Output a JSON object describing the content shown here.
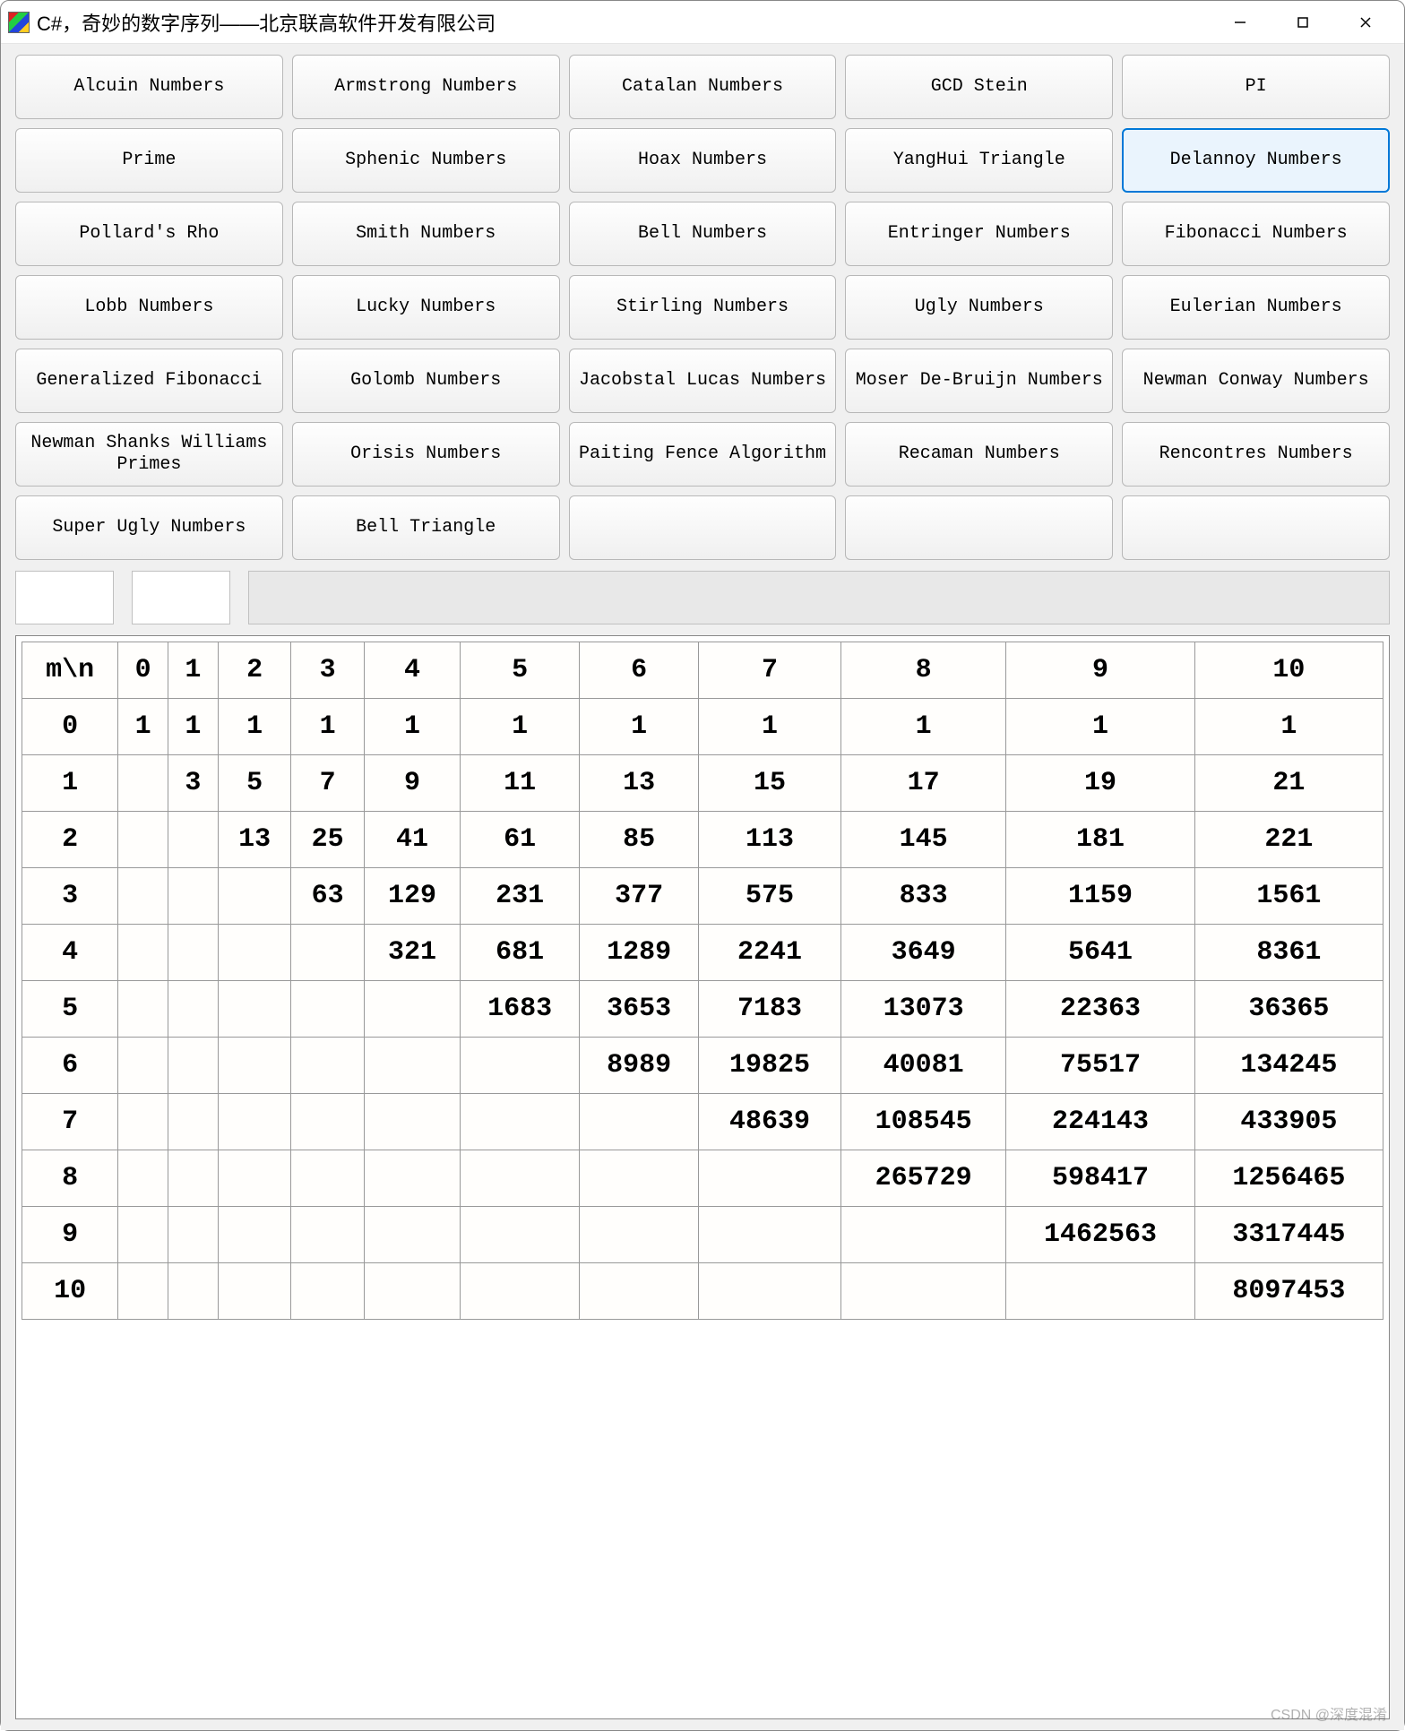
{
  "window": {
    "title": "C#，奇妙的数字序列——北京联高软件开发有限公司"
  },
  "buttons": {
    "rows": [
      [
        "Alcuin Numbers",
        "Armstrong Numbers",
        "Catalan Numbers",
        "GCD Stein",
        "PI"
      ],
      [
        "Prime",
        "Sphenic Numbers",
        "Hoax Numbers",
        "YangHui Triangle",
        "Delannoy Numbers"
      ],
      [
        "Pollard's Rho",
        "Smith Numbers",
        "Bell Numbers",
        "Entringer Numbers",
        "Fibonacci Numbers"
      ],
      [
        "Lobb Numbers",
        "Lucky Numbers",
        "Stirling Numbers",
        "Ugly Numbers",
        "Eulerian Numbers"
      ],
      [
        "Generalized Fibonacci",
        "Golomb Numbers",
        "Jacobstal Lucas Numbers",
        "Moser De-Bruijn Numbers",
        "Newman Conway Numbers"
      ],
      [
        "Newman Shanks Williams Primes",
        "Orisis Numbers",
        "Paiting Fence Algorithm",
        "Recaman Numbers",
        "Rencontres Numbers"
      ],
      [
        "Super Ugly Numbers",
        "Bell Triangle",
        "",
        "",
        ""
      ]
    ],
    "selected": "Delannoy Numbers"
  },
  "chart_data": {
    "type": "table",
    "title": "Delannoy Numbers",
    "corner_label": "m\\n",
    "columns": [
      "0",
      "1",
      "2",
      "3",
      "4",
      "5",
      "6",
      "7",
      "8",
      "9",
      "10"
    ],
    "rows": [
      "0",
      "1",
      "2",
      "3",
      "4",
      "5",
      "6",
      "7",
      "8",
      "9",
      "10"
    ],
    "cells": [
      [
        "1",
        "1",
        "1",
        "1",
        "1",
        "1",
        "1",
        "1",
        "1",
        "1",
        "1"
      ],
      [
        "",
        "3",
        "5",
        "7",
        "9",
        "11",
        "13",
        "15",
        "17",
        "19",
        "21"
      ],
      [
        "",
        "",
        "13",
        "25",
        "41",
        "61",
        "85",
        "113",
        "145",
        "181",
        "221"
      ],
      [
        "",
        "",
        "",
        "63",
        "129",
        "231",
        "377",
        "575",
        "833",
        "1159",
        "1561"
      ],
      [
        "",
        "",
        "",
        "",
        "321",
        "681",
        "1289",
        "2241",
        "3649",
        "5641",
        "8361"
      ],
      [
        "",
        "",
        "",
        "",
        "",
        "1683",
        "3653",
        "7183",
        "13073",
        "22363",
        "36365"
      ],
      [
        "",
        "",
        "",
        "",
        "",
        "",
        "8989",
        "19825",
        "40081",
        "75517",
        "134245"
      ],
      [
        "",
        "",
        "",
        "",
        "",
        "",
        "",
        "48639",
        "108545",
        "224143",
        "433905"
      ],
      [
        "",
        "",
        "",
        "",
        "",
        "",
        "",
        "",
        "265729",
        "598417",
        "1256465"
      ],
      [
        "",
        "",
        "",
        "",
        "",
        "",
        "",
        "",
        "",
        "1462563",
        "3317445"
      ],
      [
        "",
        "",
        "",
        "",
        "",
        "",
        "",
        "",
        "",
        "",
        "8097453"
      ]
    ]
  },
  "watermark": "CSDN @深度混淆"
}
